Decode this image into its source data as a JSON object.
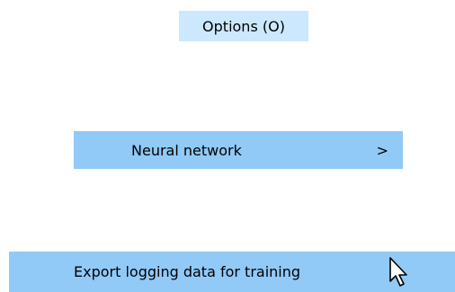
{
  "menu": {
    "title": "Options (O)"
  },
  "items": {
    "neural_network": {
      "label": "Neural network",
      "arrow_glyph": ">"
    },
    "export": {
      "label": "Export logging data for training"
    }
  },
  "cursor": {
    "icon": "mouse-pointer-icon"
  },
  "colors": {
    "title_highlight": "#cce8ff",
    "item_highlight": "#91c9f7"
  }
}
